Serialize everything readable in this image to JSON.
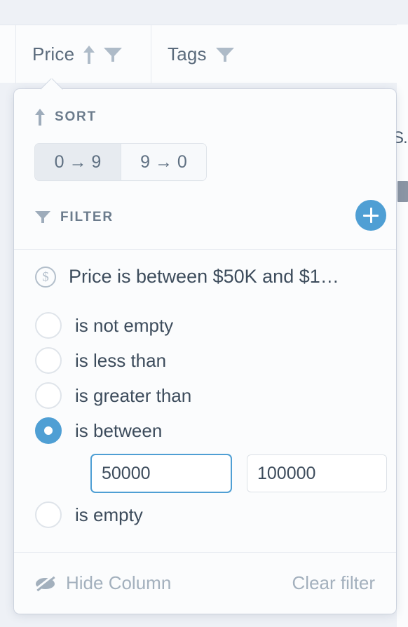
{
  "table_header": {
    "columns": [
      {
        "label": "Price",
        "sort_icon": "arrow-up-icon",
        "filter_icon": "funnel-icon"
      },
      {
        "label": "Tags",
        "filter_icon": "funnel-icon"
      }
    ],
    "truncated_cell": "S..."
  },
  "popover": {
    "sort": {
      "label": "SORT",
      "icon": "arrow-up-icon",
      "options": [
        {
          "label": "0 → 9",
          "active": true
        },
        {
          "label": "9 → 0",
          "active": false
        }
      ]
    },
    "filter": {
      "label": "FILTER",
      "icon": "funnel-icon",
      "add_button_label": "+",
      "summary": {
        "icon": "dollar-circle-icon",
        "text": "Price is between $50K and $1…"
      },
      "conditions": [
        {
          "label": "is not empty",
          "selected": false
        },
        {
          "label": "is less than",
          "selected": false
        },
        {
          "label": "is greater than",
          "selected": false
        },
        {
          "label": "is between",
          "selected": true
        },
        {
          "label": "is empty",
          "selected": false
        }
      ],
      "values": {
        "min": "50000",
        "max": "100000",
        "min_placeholder": "",
        "max_placeholder": "",
        "min_focused": true
      }
    },
    "footer": {
      "hide_column_label": "Hide Column",
      "hide_column_icon": "eye-slash-icon",
      "clear_filter_label": "Clear filter"
    }
  },
  "colors": {
    "accent": "#4f9fd4",
    "panel_bg": "#fbfcfd",
    "page_bg": "#eef1f6",
    "text": "#3d4c5c",
    "muted": "#a3b0bd",
    "icon": "#aebbc8"
  }
}
